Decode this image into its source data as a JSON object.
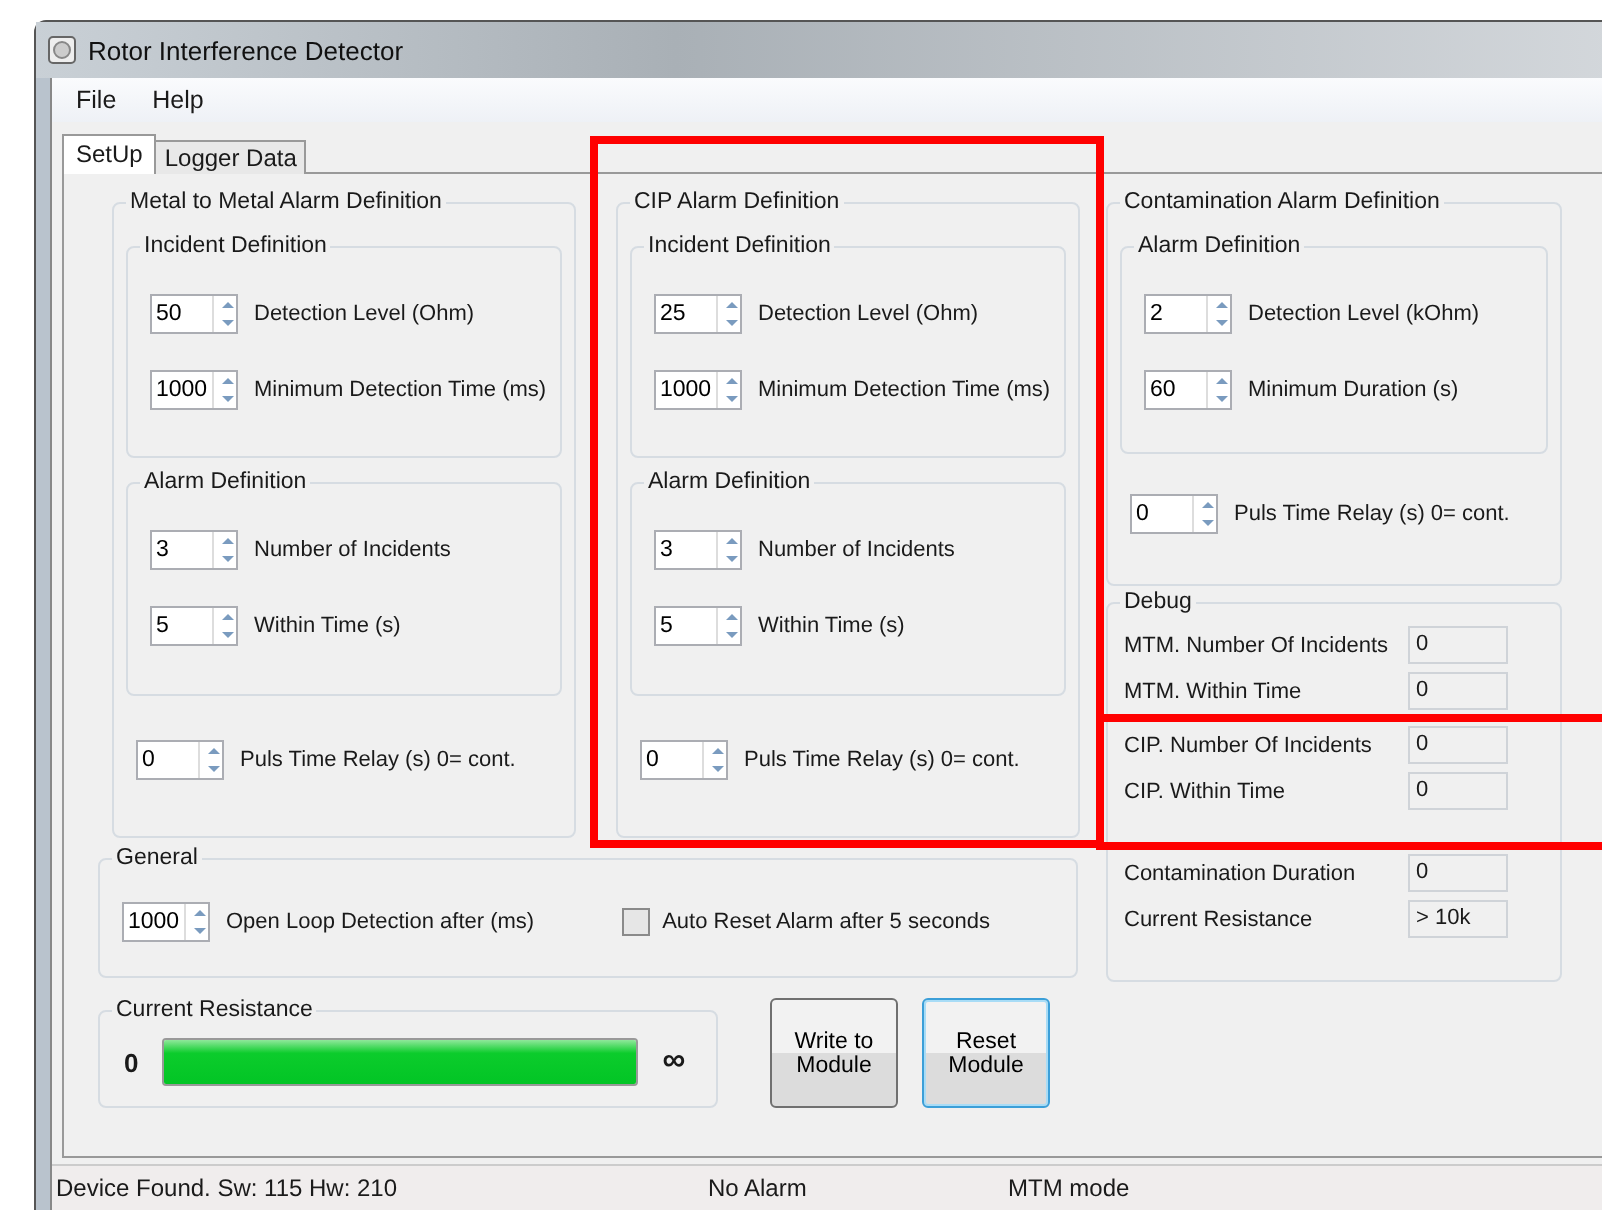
{
  "window": {
    "title": "Rotor Interference Detector"
  },
  "menu": [
    "File",
    "Help"
  ],
  "tabs": [
    {
      "label": "SetUp",
      "selected": true
    },
    {
      "label": "Logger Data",
      "selected": false
    }
  ],
  "groups": [
    {
      "title": "Metal to Metal Alarm Definition",
      "highlighted": false,
      "sections": [
        {
          "title": "Incident Definition",
          "fields": [
            {
              "value": "50",
              "label": "Detection Level (Ohm)"
            },
            {
              "value": "1000",
              "label": "Minimum Detection Time (ms)"
            }
          ]
        },
        {
          "title": "Alarm Definition",
          "fields": [
            {
              "value": "3",
              "label": "Number of Incidents"
            },
            {
              "value": "5",
              "label": "Within Time (s)"
            }
          ]
        }
      ],
      "relay": {
        "value": "0",
        "label": "Puls Time Relay (s) 0= cont."
      }
    },
    {
      "title": "CIP Alarm Definition",
      "highlighted": true,
      "sections": [
        {
          "title": "Incident Definition",
          "fields": [
            {
              "value": "25",
              "label": "Detection Level (Ohm)"
            },
            {
              "value": "1000",
              "label": "Minimum Detection Time (ms)"
            }
          ]
        },
        {
          "title": "Alarm Definition",
          "fields": [
            {
              "value": "3",
              "label": "Number of Incidents"
            },
            {
              "value": "5",
              "label": "Within Time (s)"
            }
          ]
        }
      ],
      "relay": {
        "value": "0",
        "label": "Puls Time Relay (s) 0= cont."
      }
    }
  ],
  "contamination": {
    "title": "Contamination Alarm Definition",
    "section": {
      "title": "Alarm  Definition",
      "fields": [
        {
          "value": "2",
          "label": "Detection Level (kOhm)"
        },
        {
          "value": "60",
          "label": "Minimum Duration (s)"
        }
      ]
    },
    "relay": {
      "value": "0",
      "label": "Puls Time Relay (s) 0= cont."
    }
  },
  "debug": {
    "title": "Debug",
    "rows": [
      {
        "label": "MTM. Number Of Incidents",
        "value": "0",
        "highlighted": false
      },
      {
        "label": "MTM. Within Time",
        "value": "0",
        "highlighted": false
      },
      {
        "label": "CIP. Number Of Incidents",
        "value": "0",
        "highlighted": true
      },
      {
        "label": "CIP. Within Time",
        "value": "0",
        "highlighted": true
      },
      {
        "label": "Contamination  Duration",
        "value": "0",
        "highlighted": false
      },
      {
        "label": "Current Resistance",
        "value": "> 10k",
        "highlighted": false
      }
    ]
  },
  "general": {
    "title": "General",
    "spinner": {
      "value": "1000",
      "label": "Open Loop Detection after (ms)"
    },
    "checkbox": {
      "label": "Auto Reset Alarm after 5 seconds",
      "checked": false
    }
  },
  "resistance": {
    "title": "Current Resistance",
    "min": "0",
    "max": "∞",
    "level": 1
  },
  "buttons": [
    {
      "label": "Write to Module",
      "focused": false
    },
    {
      "label": "Reset Module",
      "focused": true
    }
  ],
  "status": [
    "Device Found. Sw: 115 Hw: 210",
    "No Alarm",
    "MTM mode"
  ]
}
